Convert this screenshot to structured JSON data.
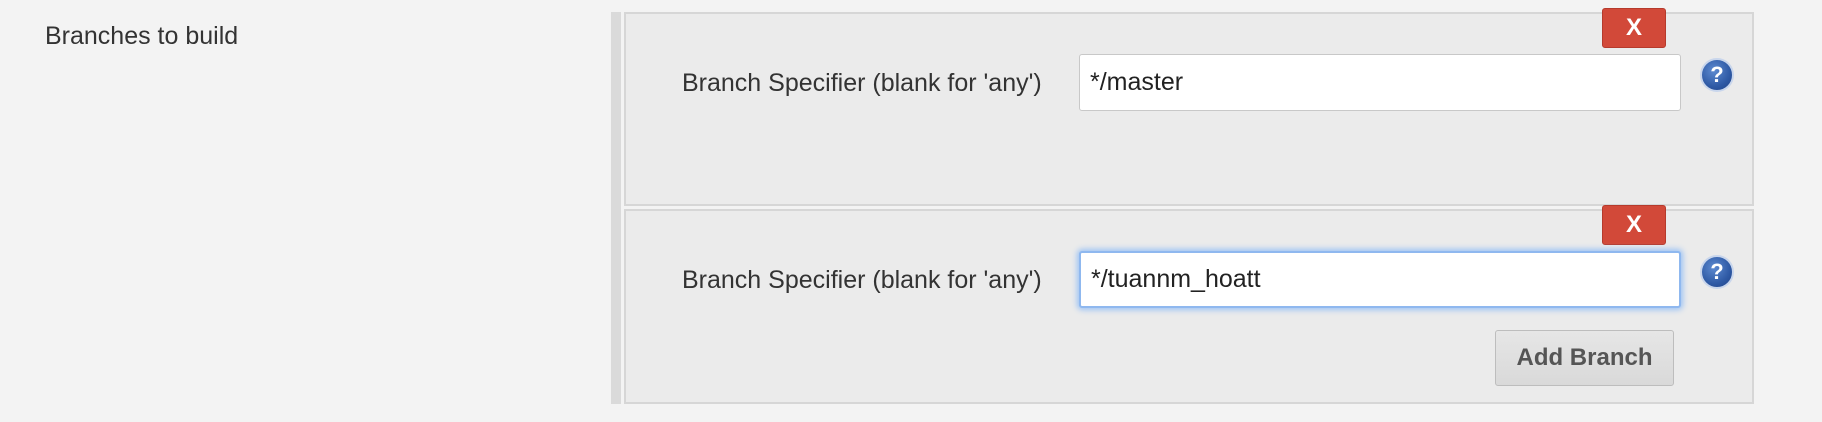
{
  "section": {
    "label": "Branches to build"
  },
  "branches": [
    {
      "delete_label": "X",
      "field_label": "Branch Specifier (blank for 'any')",
      "value": "*/master",
      "help_label": "?"
    },
    {
      "delete_label": "X",
      "field_label": "Branch Specifier (blank for 'any')",
      "value": "*/tuannm_hoatt",
      "help_label": "?"
    }
  ],
  "add_branch_label": "Add Branch",
  "colors": {
    "delete_button": "#d24939",
    "focus_ring": "#8fb8ef",
    "help_icon": "#2f5aa5"
  }
}
